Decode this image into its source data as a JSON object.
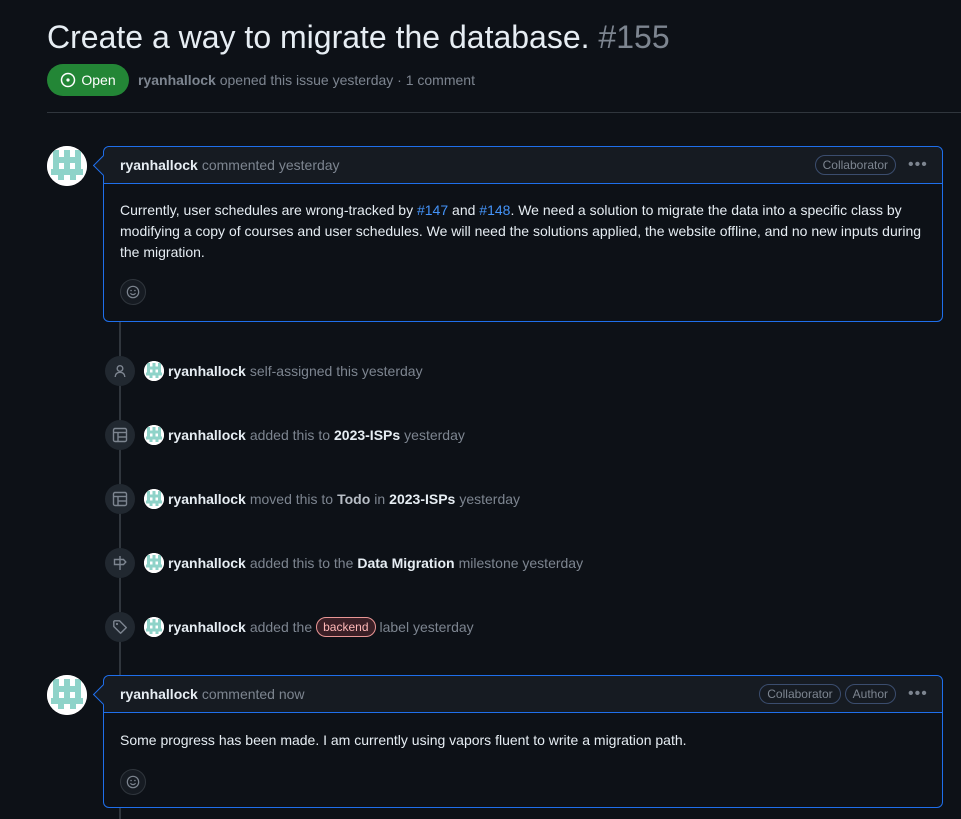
{
  "issue": {
    "title": "Create a way to migrate the database.",
    "number": "#155",
    "state_label": "Open",
    "author": "ryanhallock",
    "meta_text": "opened this issue yesterday · 1 comment"
  },
  "comments": [
    {
      "author": "ryanhallock",
      "action": "commented yesterday",
      "roles": [
        "Collaborator"
      ],
      "body_pre": "Currently, user schedules are wrong-tracked by",
      "link1": "#147",
      "body_mid": "and",
      "link2": "#148",
      "body_post": ". We need a solution to migrate the data into a specific class by modifying a copy of courses and user schedules. We will need the solutions applied, the website offline, and no new inputs during the migration."
    },
    {
      "author": "ryanhallock",
      "action": "commented now",
      "roles": [
        "Collaborator",
        "Author"
      ],
      "body": "Some progress has been made. I am currently using vapors fluent to write a migration path."
    }
  ],
  "events": [
    {
      "icon": "person-icon",
      "actor": "ryanhallock",
      "text": "self-assigned this yesterday"
    },
    {
      "icon": "project-table-icon",
      "actor": "ryanhallock",
      "t1": "added this to",
      "strong1": "2023-ISPs",
      "t2": "yesterday"
    },
    {
      "icon": "project-table-icon",
      "actor": "ryanhallock",
      "t1": "moved this to",
      "strong1": "Todo",
      "t2": "in",
      "strong2": "2023-ISPs",
      "t3": "yesterday"
    },
    {
      "icon": "milestone-icon",
      "actor": "ryanhallock",
      "t1": "added this to the",
      "strong1": "Data Migration",
      "t2": "milestone yesterday"
    },
    {
      "icon": "tag-icon",
      "actor": "ryanhallock",
      "t1": "added the",
      "label": "backend",
      "t2": "label yesterday"
    }
  ],
  "colors": {
    "background": "#0d1117",
    "open_green": "#238636",
    "link_blue": "#4493f8",
    "highlight_border": "#1f6feb",
    "label_border": "#e99695"
  }
}
